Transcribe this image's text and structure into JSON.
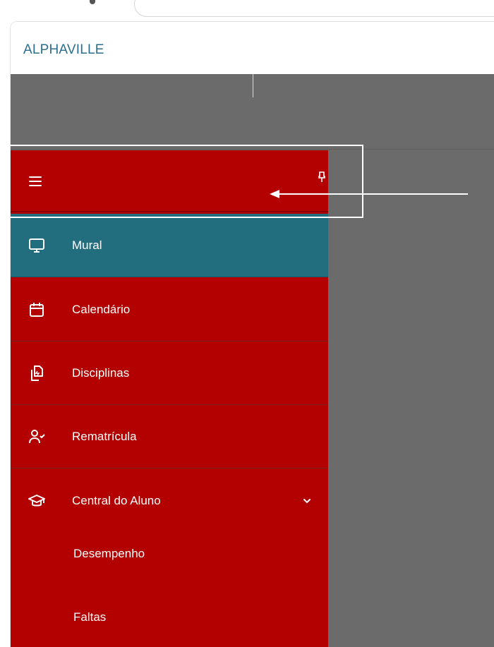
{
  "app": {
    "brand": "ALPHAVILLE"
  },
  "sidebar": {
    "items": [
      {
        "label": "Mural",
        "icon": "monitor-icon"
      },
      {
        "label": "Calendário",
        "icon": "calendar-icon"
      },
      {
        "label": "Disciplinas",
        "icon": "documents-icon"
      },
      {
        "label": "Rematrícula",
        "icon": "user-check-icon"
      },
      {
        "label": "Central do Aluno",
        "icon": "graduation-cap-icon"
      }
    ],
    "subitems": [
      {
        "label": "Desempenho"
      },
      {
        "label": "Faltas"
      }
    ]
  },
  "colors": {
    "sidebar_red": "#b30000",
    "active_teal": "#236e7e",
    "brand_blue": "#2b6f8c",
    "backdrop_gray": "#6b6b6b"
  }
}
